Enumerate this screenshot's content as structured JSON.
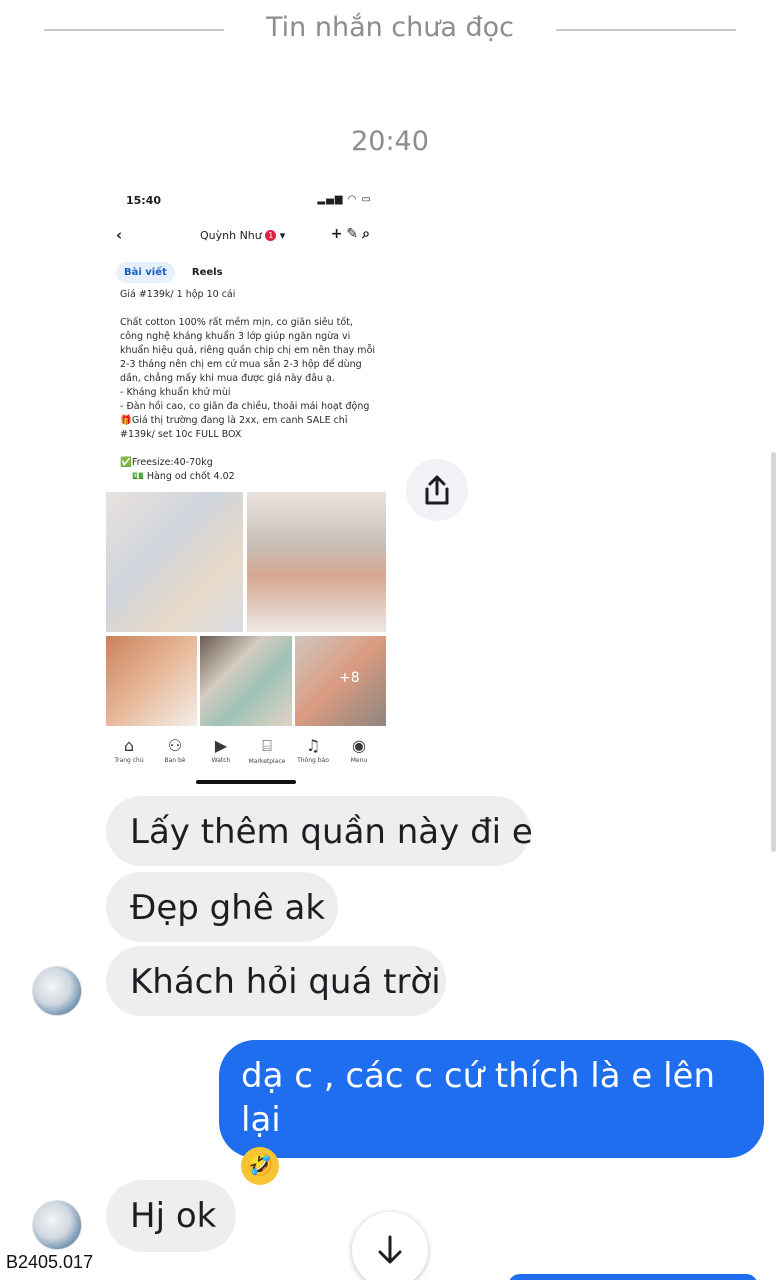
{
  "unread_divider": "Tin nhắn chưa đọc",
  "timestamp": "20:40",
  "shared_screenshot": {
    "status_time": "15:40",
    "profile_name": "Quỳnh Như",
    "profile_badge": "1",
    "tabs": [
      "Bài viết",
      "Reels"
    ],
    "post_lines": [
      "Giá #139k/ 1 hộp 10 cái",
      "",
      "Chất cotton 100% rất mềm mịn, co giãn siêu tốt,",
      "công nghệ kháng khuẩn 3 lớp giúp ngăn ngừa vi",
      "khuẩn hiệu quả, riêng quần chip chị em nên thay mỗi",
      "2-3 tháng nên chị em cứ mua sẵn 2-3 hộp để dùng",
      "dần, chẳng mấy khi mua được giá này đâu ạ.",
      "- Kháng khuẩn khử mùi",
      "- Đàn hồi cao, co giãn đa chiều, thoải mái hoạt động",
      "🎁Giá thị trường đang là 2xx, em canh SALE chỉ",
      "#139k/ set 10c FULL BOX",
      "",
      "✅Freesize:40-70kg",
      "💵 Hàng od chốt 4.02"
    ],
    "more_images": "+8",
    "bottom_nav": [
      {
        "icon": "home-icon",
        "label": "Trang chủ"
      },
      {
        "icon": "friends-icon",
        "label": "Bạn bè"
      },
      {
        "icon": "watch-icon",
        "label": "Watch"
      },
      {
        "icon": "marketplace-icon",
        "label": "Marketplace"
      },
      {
        "icon": "bell-icon",
        "label": "Thông báo"
      },
      {
        "icon": "menu-icon",
        "label": "Menu"
      }
    ]
  },
  "messages": [
    {
      "from": "them",
      "text": "Lấy thêm quần này đi e"
    },
    {
      "from": "them",
      "text": "Đẹp ghê ak"
    },
    {
      "from": "them",
      "text": "Khách hỏi quá trời"
    },
    {
      "from": "me",
      "text": "dạ c , các c cứ thích là e lên lại",
      "emoji": "🤣"
    },
    {
      "from": "them",
      "text": "Hj ok"
    }
  ],
  "watermark": "B2405.017",
  "colors": {
    "outgoing_bubble": "#1f6eef",
    "incoming_bubble": "#eeeeef",
    "muted_text": "#8a8d91"
  }
}
